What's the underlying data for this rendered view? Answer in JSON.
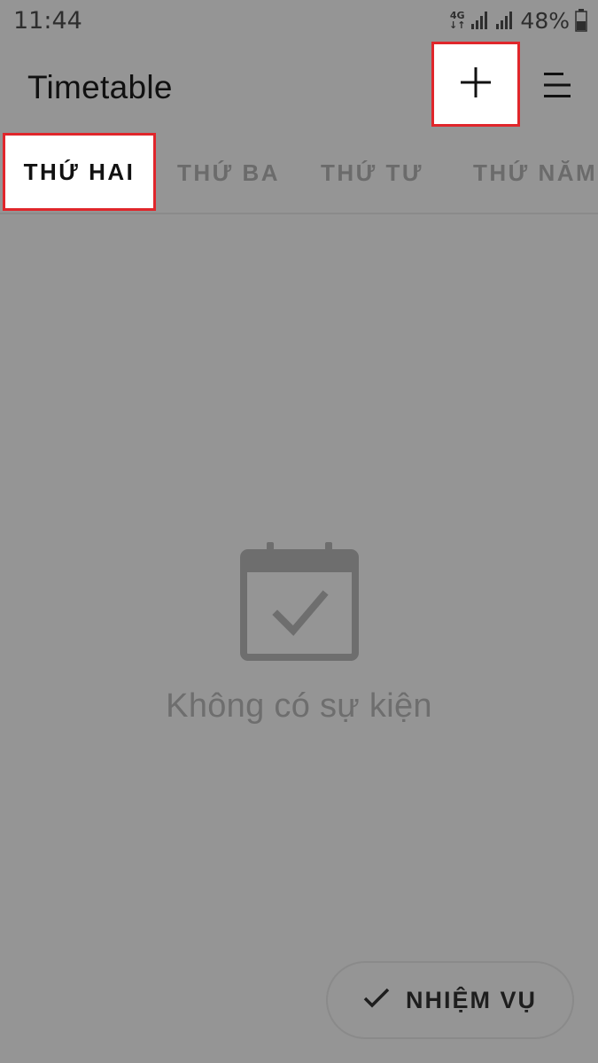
{
  "status_bar": {
    "time": "11:44",
    "network_type": "4G",
    "network_arrows": "↓↑",
    "battery_percent": "48%",
    "battery_level": 0.48
  },
  "app_bar": {
    "title": "Timetable"
  },
  "tabs": [
    {
      "label": "THỨ HAI",
      "selected": true
    },
    {
      "label": "THỨ BA",
      "selected": false
    },
    {
      "label": "THỨ TƯ",
      "selected": false
    },
    {
      "label": "THỨ NĂM",
      "selected": false
    }
  ],
  "empty_state": {
    "message": "Không có sự kiện",
    "icon": "calendar-check-icon"
  },
  "tasks_button": {
    "label": "NHIỆM VỤ",
    "icon": "check-icon"
  },
  "colors": {
    "background": "#959595",
    "highlight_border": "#e0262b"
  }
}
